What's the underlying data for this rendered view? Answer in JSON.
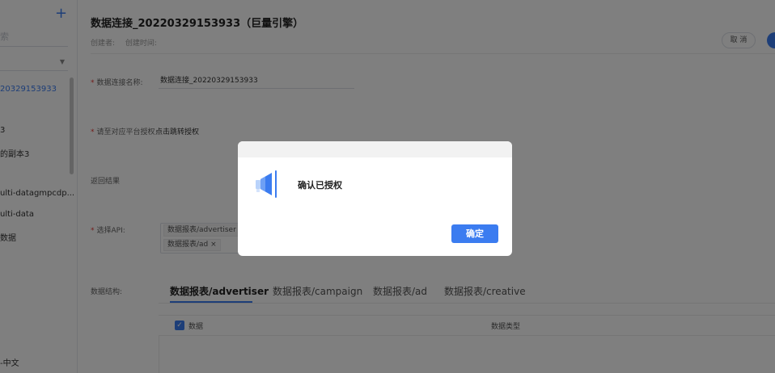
{
  "sidebar": {
    "add_icon": "plus-icon",
    "search_placeholder": "索",
    "items": [
      {
        "label": "20329153933",
        "active": true
      },
      {
        "label": "3",
        "active": false
      },
      {
        "label": "的副本3",
        "active": false
      },
      {
        "label": "ulti-datagmpcdp...",
        "active": false
      },
      {
        "label": "ulti-data",
        "active": false
      },
      {
        "label": "数据",
        "active": false
      }
    ],
    "footer_label": "-中文"
  },
  "header": {
    "title": "数据连接_20220329153933（巨量引擎）",
    "creator_label": "创建者:",
    "created_time_label": "创建时间:",
    "cancel_label": "取 消"
  },
  "form": {
    "name_label": "数据连接名称:",
    "name_value": "数据连接_20220329153933",
    "auth_label": "请至对应平台授权",
    "auth_link": "点击跳转授权",
    "result_label": "返回结果",
    "api_label": "选择API:",
    "api_tags": [
      "数据报表/advertiser",
      "数据报表/ad ×"
    ],
    "structure_label": "数据结构:"
  },
  "tabs": [
    "数据报表/advertiser",
    "数据报表/campaign",
    "数据报表/ad",
    "数据报表/creative"
  ],
  "table": {
    "col_data": "数据",
    "col_type": "数据类型"
  },
  "modal": {
    "icon": "megaphone-icon",
    "message": "确认已授权",
    "confirm_label": "确定"
  },
  "colors": {
    "accent": "#3b7cf0",
    "required": "#e53935"
  }
}
